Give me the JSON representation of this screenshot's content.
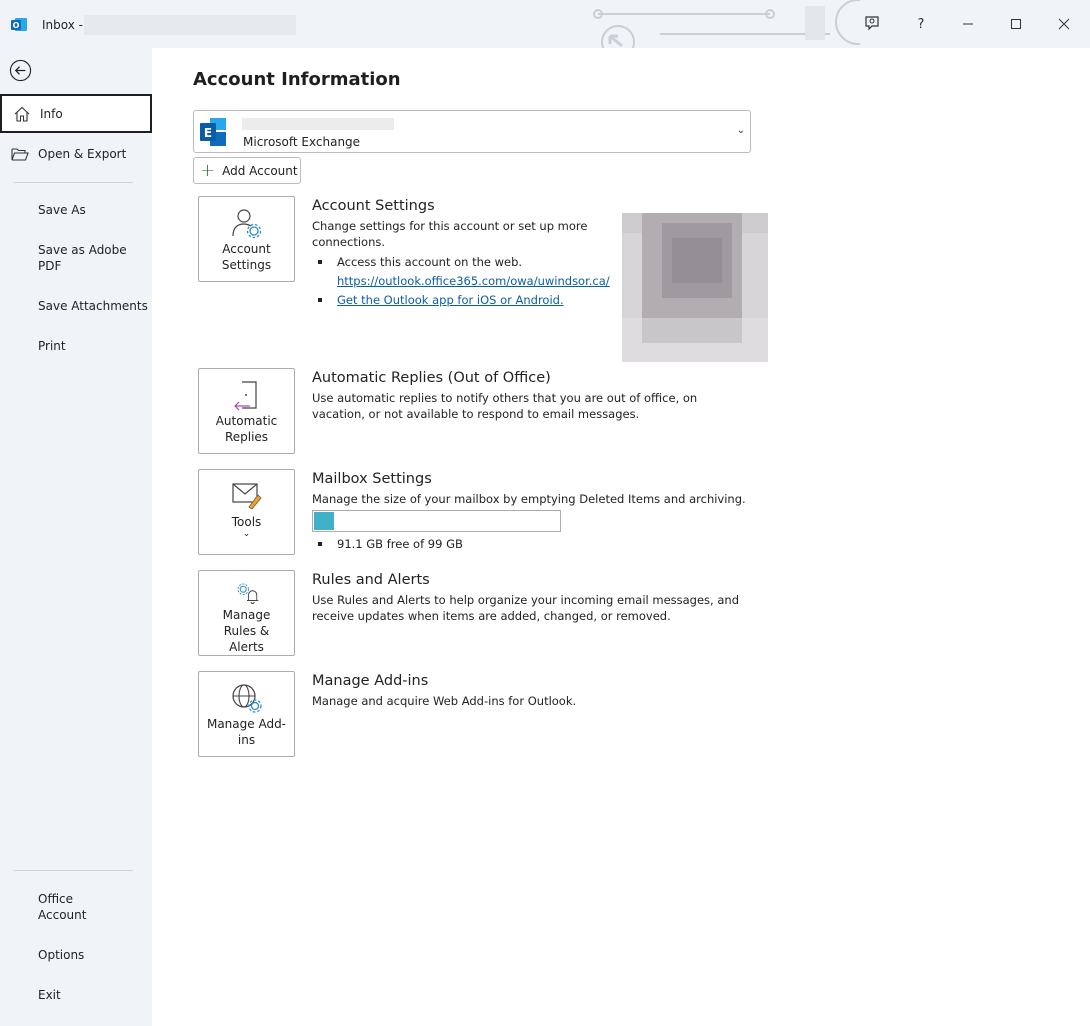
{
  "titlebar": {
    "title": "Inbox -",
    "help": "?"
  },
  "sidebar": {
    "info": "Info",
    "open_export": "Open & Export",
    "save_as": "Save As",
    "save_adobe": "Save as Adobe PDF",
    "save_attachments": "Save Attachments",
    "print": "Print",
    "office_account": "Office Account",
    "options": "Options",
    "exit": "Exit"
  },
  "main": {
    "title": "Account Information",
    "account": {
      "type": "Microsoft Exchange"
    },
    "add_account": "Add Account",
    "account_settings": {
      "tile_label": "Account Settings",
      "title": "Account Settings",
      "desc": "Change settings for this account or set up more connections.",
      "bullet_web": "Access this account on the web.",
      "web_link": "https://outlook.office365.com/owa/uwindsor.ca/",
      "app_link": "Get the Outlook app for iOS or Android."
    },
    "auto_replies": {
      "tile_label": "Automatic Replies",
      "title": "Automatic Replies (Out of Office)",
      "desc": "Use automatic replies to notify others that you are out of office, on vacation, or not available to respond to email messages."
    },
    "mailbox": {
      "tile_label": "Tools",
      "title": "Mailbox Settings",
      "desc": "Manage the size of your mailbox by emptying Deleted Items and archiving.",
      "free_text": "91.1 GB free of 99 GB",
      "used_fraction": 0.08
    },
    "rules": {
      "tile_label": "Manage Rules & Alerts",
      "title": "Rules and Alerts",
      "desc": "Use Rules and Alerts to help organize your incoming email messages, and receive updates when items are added, changed, or removed."
    },
    "addins": {
      "tile_label": "Manage Add-ins",
      "title": "Manage Add-ins",
      "desc": "Manage and acquire Web Add-ins for Outlook."
    }
  },
  "colors": {
    "accent": "#0f6cbd",
    "quota_fill": "#41b0c9",
    "link": "#0b5ea6"
  }
}
